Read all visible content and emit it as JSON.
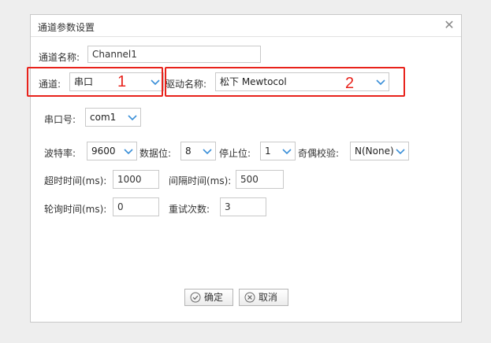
{
  "dialog": {
    "title": "通道参数设置",
    "channel_name_label": "通道名称:",
    "channel_name_value": "Channel1",
    "channel_label": "通道:",
    "channel_value": "串口",
    "driver_label": "驱动名称:",
    "driver_value": "松下 Mewtocol",
    "serial_port_label": "串口号:",
    "serial_port_value": "com1",
    "baud_label": "波特率:",
    "baud_value": "9600",
    "data_bits_label": "数据位:",
    "data_bits_value": "8",
    "stop_bits_label": "停止位:",
    "stop_bits_value": "1",
    "parity_label": "奇偶校验:",
    "parity_value": "N(None)",
    "timeout_label": "超时时间(ms):",
    "timeout_value": "1000",
    "interval_label": "间隔时间(ms):",
    "interval_value": "500",
    "poll_label": "轮询时间(ms):",
    "poll_value": "0",
    "retry_label": "重试次数:",
    "retry_value": "3",
    "ok_label": "确定",
    "cancel_label": "取消"
  },
  "annotations": {
    "marker1": "1",
    "marker2": "2",
    "color": "#e8221b"
  },
  "icons": {
    "close": "close-icon",
    "dropdown": "chevron-down-icon",
    "ok": "check-circle-icon",
    "cancel": "x-circle-icon"
  },
  "colors": {
    "accent": "#3a8fd8",
    "annotation": "#e8221b"
  }
}
